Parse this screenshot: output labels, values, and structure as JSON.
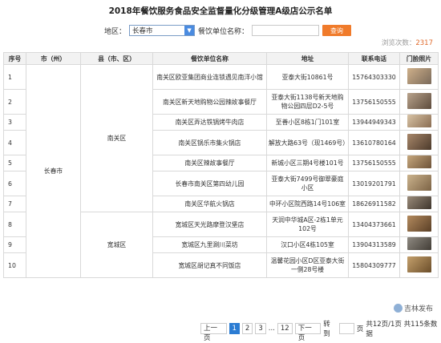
{
  "page_title": "2018年餐饮服务食品安全监督量化分级管理A级店公示名单",
  "search": {
    "region_label": "地区：",
    "region_value": "长春市",
    "name_label": "餐饮单位名称：",
    "button_label": "查询"
  },
  "views": {
    "label": "浏览次数：",
    "count": "2317"
  },
  "table": {
    "headers": [
      "序号",
      "市（州）",
      "县（市、区）",
      "餐饮单位名称",
      "地址",
      "联系电话",
      "门脸照片"
    ],
    "city": "长春市",
    "districts": [
      "南关区",
      "宽城区"
    ],
    "rows": [
      {
        "no": "1",
        "name": "南关区欧亚集团商业连锁遇见南洋小馆",
        "address": "亚泰大街10861号",
        "phone": "15764303330"
      },
      {
        "no": "2",
        "name": "南关区新天地购物公园辣故事餐厅",
        "address": "亚泰大街1138号新天地购物公园四层D2-5号",
        "phone": "13756150555"
      },
      {
        "no": "3",
        "name": "南关区弄达铁锅烤牛肉店",
        "address": "至善小区8栋1门101室",
        "phone": "13944949343"
      },
      {
        "no": "4",
        "name": "南关区锅乐市集火锅店",
        "address": "解放大路63号（现1469号）",
        "phone": "13610780164"
      },
      {
        "no": "5",
        "name": "南关区辣故事餐厅",
        "address": "新城小区三期4号楼101号",
        "phone": "13756150555"
      },
      {
        "no": "6",
        "name": "长春市南关区第四幼儿园",
        "address": "亚泰大街7499号御翠豪庭小区",
        "phone": "13019201791"
      },
      {
        "no": "7",
        "name": "南关区华航火锅店",
        "address": "中环小区院西路14号106室",
        "phone": "18626911582"
      },
      {
        "no": "8",
        "name": "宽城区天光路摩登汉堡店",
        "address": "天润中华城A区-2栋1单元102号",
        "phone": "13404373661"
      },
      {
        "no": "9",
        "name": "宽城区九里涮川菜坊",
        "address": "汉口小区4栋105室",
        "phone": "13904313589"
      },
      {
        "no": "10",
        "name": "宽城区胡记真不同饭店",
        "address": "温馨花园小区D区亚泰大街一侧28号楼",
        "phone": "15804309777"
      }
    ]
  },
  "pager": {
    "prev": "上一页",
    "p1": "1",
    "p2": "2",
    "p3": "3",
    "ellipsis": "...",
    "p12": "12",
    "next": "下一页",
    "goto": "转到",
    "page_unit": "页",
    "summary": "共12页/1页  共115条数据"
  },
  "watermark": "吉林发布",
  "colors": {
    "accent": "#2b7cd3",
    "button": "#f07b2b",
    "count": "#e06a2b"
  }
}
